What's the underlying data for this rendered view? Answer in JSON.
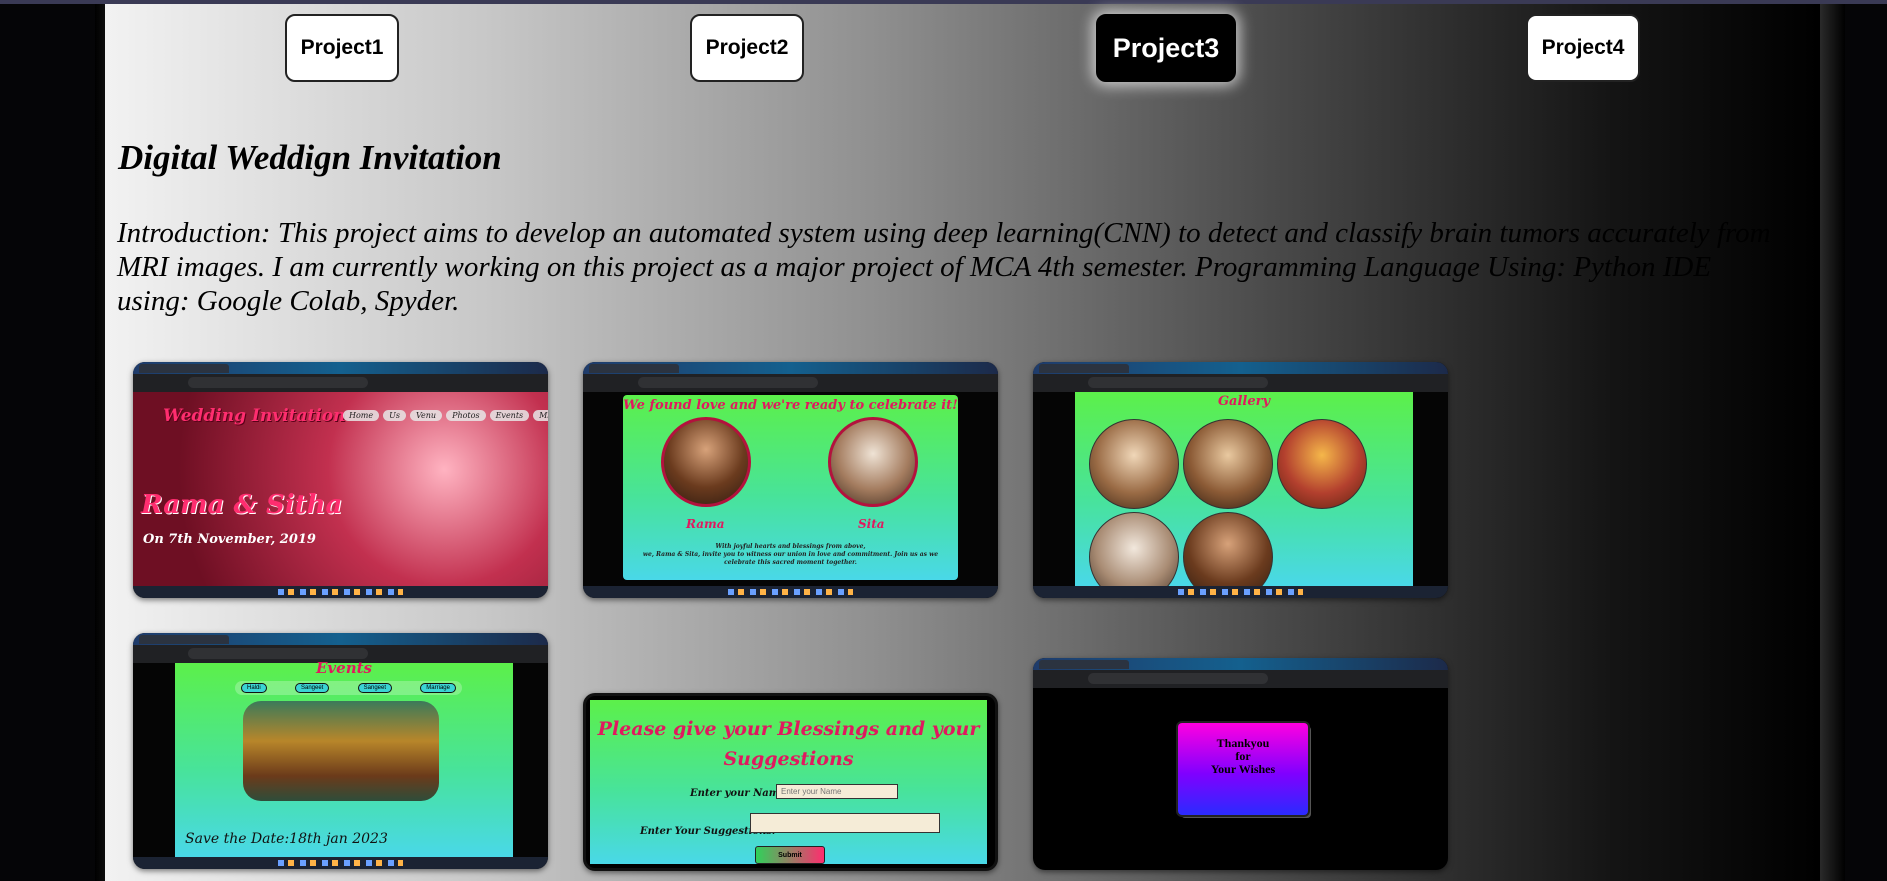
{
  "nav": {
    "buttons": [
      "Project1",
      "Project2",
      "Project3",
      "Project4"
    ],
    "active": "Project3"
  },
  "project": {
    "title": "Digital Weddign Invitation",
    "intro": "Introduction: This project aims to develop an automated system using deep learning(CNN) to detect and classify brain tumors accurately from MRI images. I am currently working on this project as a major project of MCA 4th semester. Programming Language Using: Python IDE using: Google Colab, Spyder."
  },
  "screenshots": {
    "home": {
      "heading": "Wedding Invitation",
      "menu": [
        "Home",
        "Us",
        "Venu",
        "Photos",
        "Events",
        "Msgs"
      ],
      "names": "Rama & Sitha",
      "date": "On 7th November, 2019"
    },
    "about": {
      "heading": "We found love and we're ready to celebrate it!",
      "groom": "Rama",
      "bride": "Sita",
      "blessing_line1": "With joyful hearts and blessings from above,",
      "blessing_line2": "we, Rama & Sita, invite you to witness our union in love and commitment. Join us as we",
      "blessing_line3": "celebrate this sacred moment together."
    },
    "gallery": {
      "heading": "Gallery"
    },
    "events": {
      "heading": "Events",
      "pills": [
        "Haldi",
        "Sangeet",
        "Sangeet",
        "Marriage"
      ],
      "save_date": "Save the Date:18th jan 2023"
    },
    "form": {
      "heading_line1": "Please give your Blessings and your",
      "heading_line2": "Suggestions",
      "name_label": "Enter your Name:",
      "name_placeholder": "Enter your Name",
      "suggest_label": "Enter Your Suggestions:",
      "submit": "Submit"
    },
    "thanks": {
      "line1": "Thankyou",
      "line2": "for",
      "line3": "Your Wishes"
    }
  }
}
